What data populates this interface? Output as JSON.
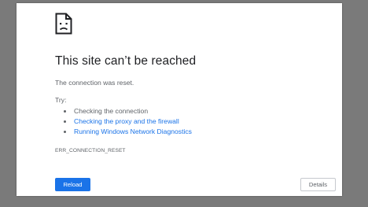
{
  "icon": "sad-page-icon",
  "title": "This site can’t be reached",
  "subtitle": "The connection was reset.",
  "try_label": "Try:",
  "suggestions": [
    {
      "text": "Checking the connection",
      "link": false
    },
    {
      "text": "Checking the proxy and the firewall",
      "link": true
    },
    {
      "text": "Running Windows Network Diagnostics",
      "link": true
    }
  ],
  "error_code": "ERR_CONNECTION_RESET",
  "buttons": {
    "reload": "Reload",
    "details": "Details"
  },
  "colors": {
    "accent": "#1a73e8",
    "backdrop": "#7a7a7a",
    "text": "#202124",
    "muted": "#5f6368"
  }
}
